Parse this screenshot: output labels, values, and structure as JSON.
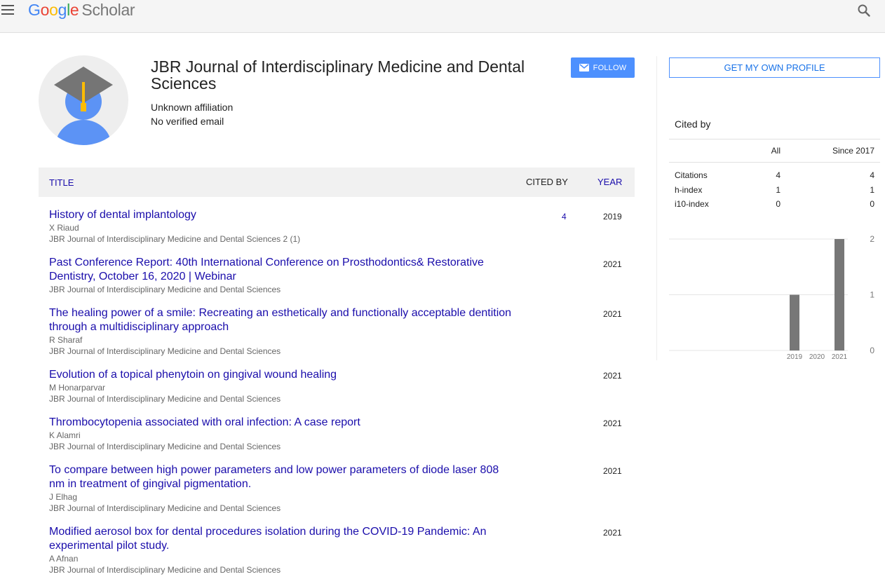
{
  "header": {
    "logo": {
      "g1": "G",
      "g2": "o",
      "g3": "o",
      "g4": "g",
      "g5": "l",
      "g6": "e",
      "product": "Scholar"
    },
    "menu_icon": "hamburger-menu-icon",
    "search_icon": "search-icon"
  },
  "profile": {
    "name": "JBR Journal of Interdisciplinary Medicine and Dental Sciences",
    "affiliation": "Unknown affiliation",
    "email_status": "No verified email",
    "follow_label": "FOLLOW",
    "follow_icon": "envelope-icon"
  },
  "table": {
    "col_title": "TITLE",
    "col_cited_by": "CITED BY",
    "col_year": "YEAR"
  },
  "articles": [
    {
      "title": "History of dental implantology",
      "authors": "X Riaud",
      "venue": "JBR Journal of Interdisciplinary Medicine and Dental Sciences 2 (1)",
      "cited_by": "4",
      "year": "2019"
    },
    {
      "title": "Past Conference Report: 40th International Conference on Prosthodontics& Restorative Dentistry, October 16, 2020 | Webinar",
      "authors": "",
      "venue": "JBR Journal of Interdisciplinary Medicine and Dental Sciences",
      "cited_by": "",
      "year": "2021"
    },
    {
      "title": "The healing power of a smile: Recreating an esthetically and functionally acceptable dentition through a multidisciplinary approach",
      "authors": "R Sharaf",
      "venue": "JBR Journal of Interdisciplinary Medicine and Dental Sciences",
      "cited_by": "",
      "year": "2021"
    },
    {
      "title": "Evolution of a topical phenytoin on gingival wound healing",
      "authors": "M Honarparvar",
      "venue": "JBR Journal of Interdisciplinary Medicine and Dental Sciences",
      "cited_by": "",
      "year": "2021"
    },
    {
      "title": "Thrombocytopenia associated with oral infection: A case report",
      "authors": "K Alamri",
      "venue": "JBR Journal of Interdisciplinary Medicine and Dental Sciences",
      "cited_by": "",
      "year": "2021"
    },
    {
      "title": "To compare between high power parameters and low power parameters of diode laser 808 nm in treatment of gingival pigmentation.",
      "authors": "J Elhag",
      "venue": "JBR Journal of Interdisciplinary Medicine and Dental Sciences",
      "cited_by": "",
      "year": "2021"
    },
    {
      "title": "Modified aerosol box for dental procedures isolation during the COVID-19 Pandemic: An experimental pilot study.",
      "authors": "A Afnan",
      "venue": "JBR Journal of Interdisciplinary Medicine and Dental Sciences",
      "cited_by": "",
      "year": "2021"
    }
  ],
  "sidebar": {
    "get_profile_label": "GET MY OWN PROFILE",
    "cited_by_title": "Cited by",
    "col_all": "All",
    "col_since": "Since 2017",
    "rows": [
      {
        "label": "Citations",
        "all": "4",
        "since": "4"
      },
      {
        "label": "h-index",
        "all": "1",
        "since": "1"
      },
      {
        "label": "i10-index",
        "all": "0",
        "since": "0"
      }
    ]
  },
  "chart_data": {
    "type": "bar",
    "categories": [
      "2019",
      "2020",
      "2021"
    ],
    "values": [
      1,
      0,
      2
    ],
    "ylim": [
      0,
      2
    ],
    "yticks": [
      "0",
      "1",
      "2"
    ],
    "grid": true,
    "bar_color": "#777777"
  }
}
